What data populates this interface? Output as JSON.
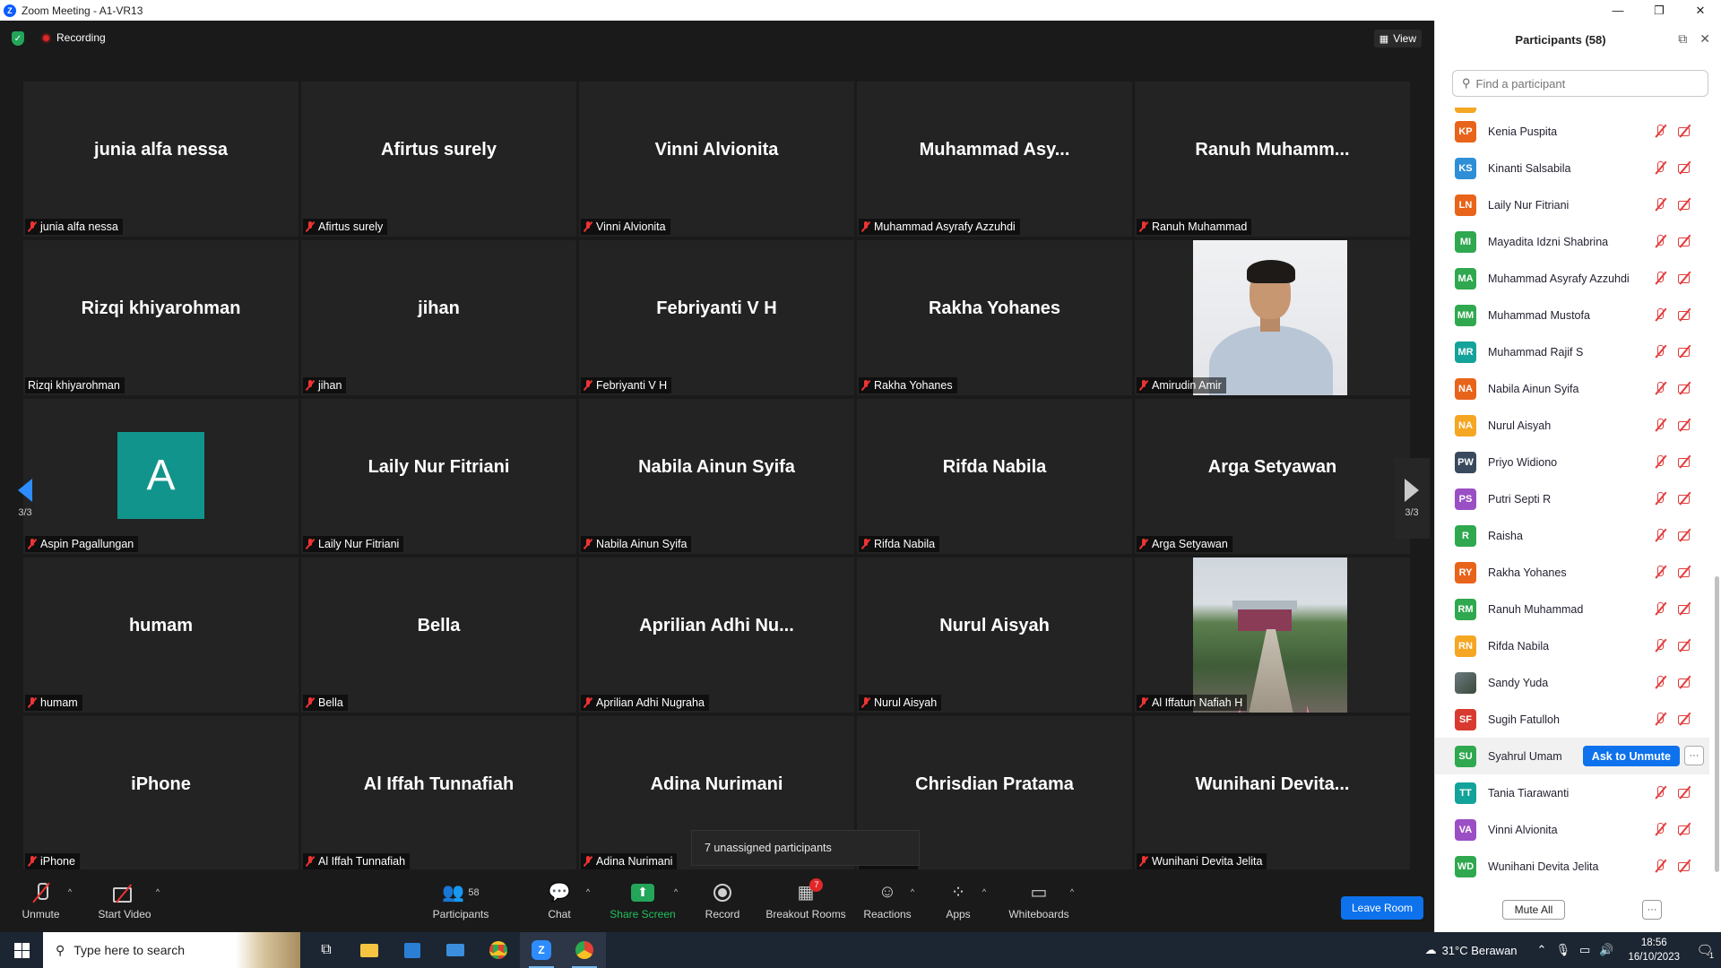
{
  "window": {
    "title": "Zoom Meeting - A1-VR13",
    "logo_letter": "Z",
    "minimize": "—",
    "restore": "❐",
    "close": "✕"
  },
  "meeting": {
    "recording_label": "Recording",
    "view_label": "View",
    "page_indicator_left": "3/3",
    "page_indicator_right": "3/3",
    "tooltip": "7 unassigned participants"
  },
  "tiles": [
    {
      "display": "junia alfa nessa",
      "tag": "junia alfa nessa",
      "muted": true,
      "type": "name"
    },
    {
      "display": "Afirtus surely",
      "tag": "Afirtus surely",
      "muted": true,
      "type": "name"
    },
    {
      "display": "Vinni Alvionita",
      "tag": "Vinni Alvionita",
      "muted": true,
      "type": "name"
    },
    {
      "display": "Muhammad  Asy...",
      "tag": "Muhammad Asyrafy Azzuhdi",
      "muted": true,
      "type": "name"
    },
    {
      "display": "Ranuh  Muhamm...",
      "tag": "Ranuh Muhammad",
      "muted": true,
      "type": "name"
    },
    {
      "display": "Rizqi khiyarohman",
      "tag": "Rizqi khiyarohman",
      "muted": false,
      "type": "name"
    },
    {
      "display": "jihan",
      "tag": "jihan",
      "muted": true,
      "type": "name"
    },
    {
      "display": "Febriyanti V H",
      "tag": "Febriyanti V H",
      "muted": true,
      "type": "name"
    },
    {
      "display": "Rakha Yohanes",
      "tag": "Rakha Yohanes",
      "muted": true,
      "type": "name"
    },
    {
      "display": "",
      "tag": "Amirudin Amir",
      "muted": true,
      "type": "portrait"
    },
    {
      "display": "A",
      "tag": "Aspin Pagallungan",
      "muted": true,
      "type": "avatar"
    },
    {
      "display": "Laily Nur Fitriani",
      "tag": "Laily Nur Fitriani",
      "muted": true,
      "type": "name"
    },
    {
      "display": "Nabila Ainun Syifa",
      "tag": "Nabila Ainun Syifa",
      "muted": true,
      "type": "name"
    },
    {
      "display": "Rifda Nabila",
      "tag": "Rifda Nabila",
      "muted": true,
      "type": "name"
    },
    {
      "display": "Arga Setyawan",
      "tag": "Arga Setyawan",
      "muted": true,
      "type": "name"
    },
    {
      "display": "humam",
      "tag": "humam",
      "muted": true,
      "type": "name"
    },
    {
      "display": "Bella",
      "tag": "Bella",
      "muted": true,
      "type": "name"
    },
    {
      "display": "Aprilian  Adhi  Nu...",
      "tag": "Aprilian Adhi Nugraha",
      "muted": true,
      "type": "name"
    },
    {
      "display": "Nurul Aisyah",
      "tag": "Nurul Aisyah",
      "muted": true,
      "type": "name"
    },
    {
      "display": "",
      "tag": "Al Iffatun Nafiah H",
      "muted": true,
      "type": "landscape"
    },
    {
      "display": "iPhone",
      "tag": "iPhone",
      "muted": true,
      "type": "name"
    },
    {
      "display": "Al Iffah Tunnafiah",
      "tag": "Al Iffah Tunnafiah",
      "muted": true,
      "type": "name"
    },
    {
      "display": "Adina Nurimani",
      "tag": "Adina Nurimani",
      "muted": true,
      "type": "name"
    },
    {
      "display": "Chrisdian Pratama",
      "tag": "n Pratama",
      "muted": false,
      "type": "name"
    },
    {
      "display": "Wunihani  Devita...",
      "tag": "Wunihani Devita Jelita",
      "muted": true,
      "type": "name"
    }
  ],
  "toolbar": {
    "unmute": "Unmute",
    "start_video": "Start Video",
    "participants": "Participants",
    "participants_count": "58",
    "chat": "Chat",
    "share_screen": "Share Screen",
    "record": "Record",
    "breakout_rooms": "Breakout Rooms",
    "breakout_badge": "7",
    "reactions": "Reactions",
    "apps": "Apps",
    "whiteboards": "Whiteboards",
    "leave_room": "Leave Room"
  },
  "panel": {
    "title": "Participants (58)",
    "search_placeholder": "Find a participant",
    "ask_to_unmute": "Ask to Unmute",
    "more": "···",
    "mute_all": "Mute All",
    "participants": [
      {
        "initials": "KP",
        "name": "Kenia Puspita",
        "color": "#e8641b"
      },
      {
        "initials": "KS",
        "name": "Kinanti Salsabila",
        "color": "#2f8fd6"
      },
      {
        "initials": "LN",
        "name": "Laily Nur Fitriani",
        "color": "#e8641b"
      },
      {
        "initials": "MI",
        "name": "Mayadita Idzni Shabrina",
        "color": "#2fa84f"
      },
      {
        "initials": "MA",
        "name": "Muhammad Asyrafy Azzuhdi",
        "color": "#2fa84f"
      },
      {
        "initials": "MM",
        "name": "Muhammad Mustofa",
        "color": "#2fa84f"
      },
      {
        "initials": "MR",
        "name": "Muhammad Rajif S",
        "color": "#14a39a"
      },
      {
        "initials": "NA",
        "name": "Nabila Ainun Syifa",
        "color": "#e8641b"
      },
      {
        "initials": "NA",
        "name": "Nurul Aisyah",
        "color": "#f5a623"
      },
      {
        "initials": "PW",
        "name": "Priyo Widiono",
        "color": "#3a4a5e"
      },
      {
        "initials": "PS",
        "name": "Putri Septi R",
        "color": "#9b4fc4"
      },
      {
        "initials": "R",
        "name": "Raisha",
        "color": "#2fa84f"
      },
      {
        "initials": "RY",
        "name": "Rakha Yohanes",
        "color": "#e8641b"
      },
      {
        "initials": "RM",
        "name": "Ranuh Muhammad",
        "color": "#2fa84f"
      },
      {
        "initials": "RN",
        "name": "Rifda Nabila",
        "color": "#f5a623"
      },
      {
        "initials": "",
        "name": "Sandy Yuda",
        "color": "#5a6a6e"
      },
      {
        "initials": "SF",
        "name": "Sugih Fatulloh",
        "color": "#d93a2f"
      },
      {
        "initials": "SU",
        "name": "Syahrul Umam",
        "color": "#2fa84f"
      },
      {
        "initials": "TT",
        "name": "Tania Tiarawanti",
        "color": "#14a39a"
      },
      {
        "initials": "VA",
        "name": "Vinni Alvionita",
        "color": "#9b4fc4"
      },
      {
        "initials": "WD",
        "name": "Wunihani Devita Jelita",
        "color": "#2fa84f"
      }
    ]
  },
  "taskbar": {
    "search_placeholder": "Type here to search",
    "weather": "31°C  Berawan",
    "time": "18:56",
    "date": "16/10/2023",
    "notification_count": "1"
  }
}
